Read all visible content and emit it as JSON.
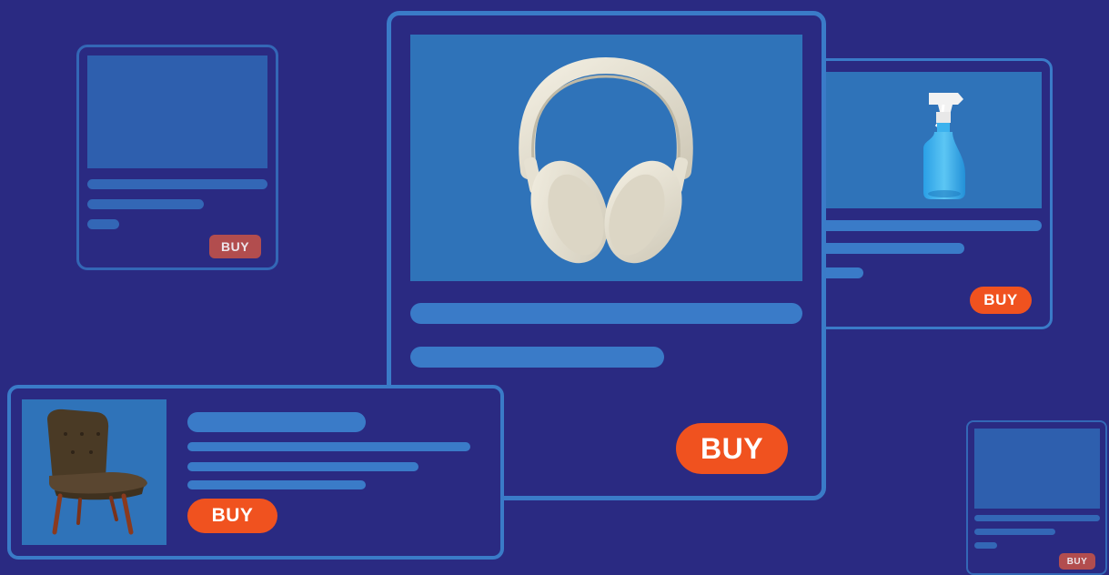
{
  "colors": {
    "background": "#2a2a82",
    "card_border": "#3a7bc8",
    "image_fill": "#2f73b9",
    "buy_button": "#f0521f",
    "buy_button_faded": "#b24d4e"
  },
  "cards": {
    "small_top_left": {
      "buy_label": "BUY",
      "image": "placeholder"
    },
    "featured_headphones": {
      "buy_label": "BUY",
      "image": "headphones-icon"
    },
    "spray_bottle": {
      "buy_label": "BUY",
      "image": "spray-bottle-icon"
    },
    "chair": {
      "buy_label": "BUY",
      "image": "armchair-icon"
    },
    "small_bottom_right": {
      "buy_label": "BUY",
      "image": "placeholder"
    }
  }
}
